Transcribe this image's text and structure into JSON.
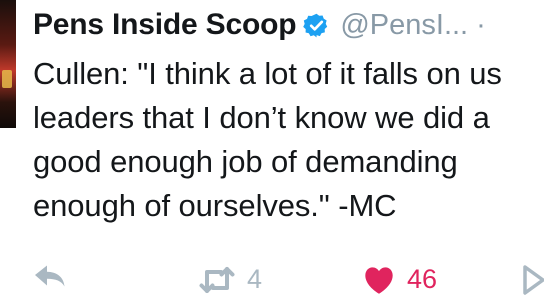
{
  "tweet": {
    "author_name": "Pens Inside Scoop",
    "handle": "@PensI... ·",
    "text": "Cullen: \"I think a lot of it falls on us\nleaders that I don’t know we did a\ngood enough job of demanding\nenough of ourselves.\" -MC",
    "verified": true
  },
  "actions": {
    "reply_icon": "reply-icon",
    "retweet_icon": "retweet-icon",
    "retweet_count": "4",
    "like_icon": "heart-icon",
    "like_count": "46",
    "dm_icon": "direct-message-icon"
  },
  "colors": {
    "text": "#14171a",
    "muted": "#8899a6",
    "icon": "#aab8c2",
    "verified": "#1da1f2",
    "like": "#e0245e"
  }
}
